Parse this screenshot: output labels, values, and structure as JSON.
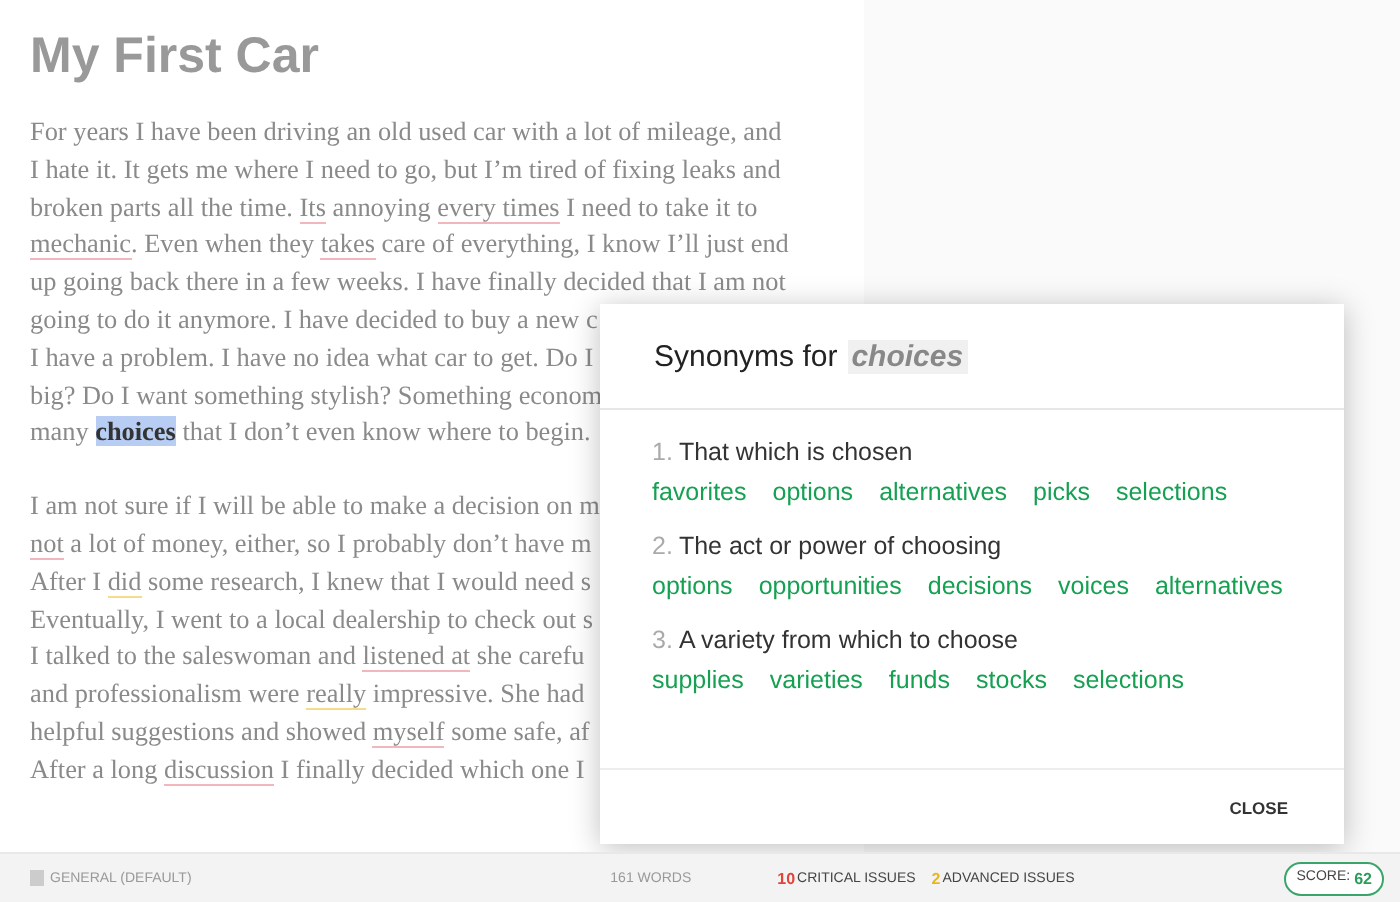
{
  "document": {
    "title": "My First Car",
    "paragraphs": [
      {
        "lines": [
          [
            {
              "text": "For years I have been driving an old used car with a lot of mileage, and"
            }
          ],
          [
            {
              "text": "I hate it. It gets me where I need to go, but I’m tired of fixing leaks and"
            }
          ],
          [
            {
              "text": "broken parts all the time. "
            },
            {
              "text": "Its",
              "critical": true
            },
            {
              "text": " annoying "
            },
            {
              "text": "every times",
              "critical": true
            },
            {
              "text": " I need to take it to"
            }
          ],
          [
            {
              "text": "mechanic",
              "critical": true
            },
            {
              "text": ". Even when they "
            },
            {
              "text": "takes",
              "critical": true
            },
            {
              "text": " care of everything, I know I’ll just end"
            }
          ],
          [
            {
              "text": "up going back there in a few weeks. I have finally decided that I am not"
            }
          ],
          [
            {
              "text": "going to do it anymore. I have decided to buy a new c"
            }
          ],
          [
            {
              "text": "I have a problem. I have no idea what car to get. Do I"
            }
          ],
          [
            {
              "text": "big? Do I want something stylish? Something econom"
            }
          ],
          [
            {
              "text": "many "
            },
            {
              "text": "choices",
              "selected": true
            },
            {
              "text": " that I don’t even know where to begin."
            }
          ]
        ]
      },
      {
        "lines": [
          [
            {
              "text": "I am not sure if I will be able to make a decision on m"
            }
          ],
          [
            {
              "text": "not",
              "critical": true
            },
            {
              "text": " a lot of money, either, so I probably don’t have m"
            }
          ],
          [
            {
              "text": "After I "
            },
            {
              "text": "did",
              "advanced": true
            },
            {
              "text": " some research, I knew that I would need s"
            }
          ],
          [
            {
              "text": "Eventually, I went to a local dealership to check out s"
            }
          ],
          [
            {
              "text": "I talked to the saleswoman and "
            },
            {
              "text": "listened at",
              "critical": true
            },
            {
              "text": " she carefu"
            }
          ],
          [
            {
              "text": "and professionalism were "
            },
            {
              "text": "really",
              "advanced": true
            },
            {
              "text": " impressive. She had"
            }
          ],
          [
            {
              "text": "helpful suggestions and showed "
            },
            {
              "text": "myself",
              "critical": true
            },
            {
              "text": " some safe, af"
            }
          ],
          [
            {
              "text": "After a long "
            },
            {
              "text": "discussion",
              "critical": true
            },
            {
              "text": " I finally decided which one I"
            }
          ]
        ]
      }
    ]
  },
  "synonyms_dialog": {
    "title": "Synonyms for",
    "word": "choices",
    "senses": [
      {
        "number": "1.",
        "definition": "That which is chosen",
        "words": [
          "favorites",
          "options",
          "alternatives",
          "picks",
          "selections"
        ]
      },
      {
        "number": "2.",
        "definition": "The act or power of choosing",
        "words": [
          "options",
          "opportunities",
          "decisions",
          "voices",
          "alternatives"
        ]
      },
      {
        "number": "3.",
        "definition": "A variety from which to choose",
        "words": [
          "supplies",
          "varieties",
          "funds",
          "stocks",
          "selections"
        ]
      }
    ],
    "close": "CLOSE"
  },
  "status_bar": {
    "mode": "GENERAL (DEFAULT)",
    "word_count": "161 WORDS",
    "critical_count": "10",
    "critical_label": "CRITICAL ISSUES",
    "advanced_count": "2",
    "advanced_label": "ADVANCED ISSUES",
    "score_label": "SCORE:",
    "score": "62"
  }
}
